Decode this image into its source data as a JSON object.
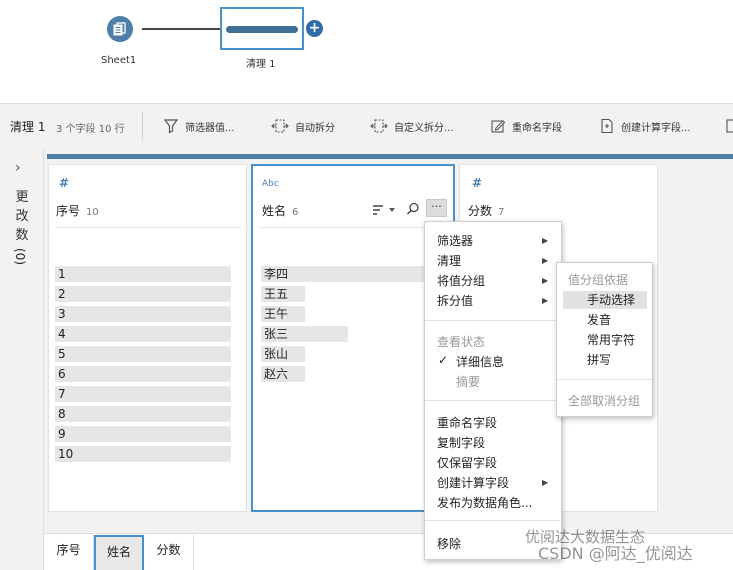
{
  "flow": {
    "source_node_label": "Sheet1",
    "clean_node_label": "清理 1",
    "add_step": "+"
  },
  "toolbar": {
    "step_name": "清理 1",
    "meta": "3 个字段  10 行",
    "buttons": [
      "筛选器值...",
      "自动拆分",
      "自定义拆分...",
      "重命名字段",
      "创建计算字段..."
    ]
  },
  "left_panel": {
    "chevron": "›",
    "label_chars": [
      "更",
      "改",
      "数"
    ],
    "count": "(0)"
  },
  "cards": [
    {
      "type_icon": "#",
      "name": "序号",
      "count": "10",
      "values": [
        "1",
        "2",
        "3",
        "4",
        "5",
        "6",
        "7",
        "8",
        "9",
        "10"
      ],
      "bar_fractions": [
        1,
        1,
        1,
        1,
        1,
        1,
        1,
        1,
        1,
        1
      ]
    },
    {
      "type_icon": "Abc",
      "name": "姓名",
      "count": "6",
      "values": [
        "李四",
        "王五",
        "王午",
        "张三",
        "张山",
        "赵六"
      ],
      "bar_fractions": [
        1,
        0.27,
        0.27,
        0.53,
        0.27,
        0.27
      ],
      "more": "···"
    },
    {
      "type_icon": "#",
      "name": "分数",
      "count": "7"
    }
  ],
  "context_menu": {
    "items": [
      "筛选器",
      "清理",
      "将值分组",
      "拆分值"
    ],
    "view_state_header": "查看状态",
    "detail_check": "✓",
    "detail": "详细信息",
    "summary": "摘要",
    "actions": [
      "重命名字段",
      "复制字段",
      "仅保留字段",
      "创建计算字段",
      "发布为数据角色..."
    ],
    "remove": "移除"
  },
  "submenu": {
    "header": "值分组依据",
    "items": [
      "手动选择",
      "发音",
      "常用字符",
      "拼写"
    ],
    "ungroup_all": "全部取消分组"
  },
  "bottom_tabs": [
    "序号",
    "姓名",
    "分数"
  ],
  "watermark": {
    "line1": "优阅达大数据生态",
    "line2": "CSDN @阿达_优阅达"
  },
  "colors": {
    "accent_blue": "#4a90c9",
    "node_blue": "#4f7fa8",
    "bar_gray": "#e6e6e6"
  }
}
